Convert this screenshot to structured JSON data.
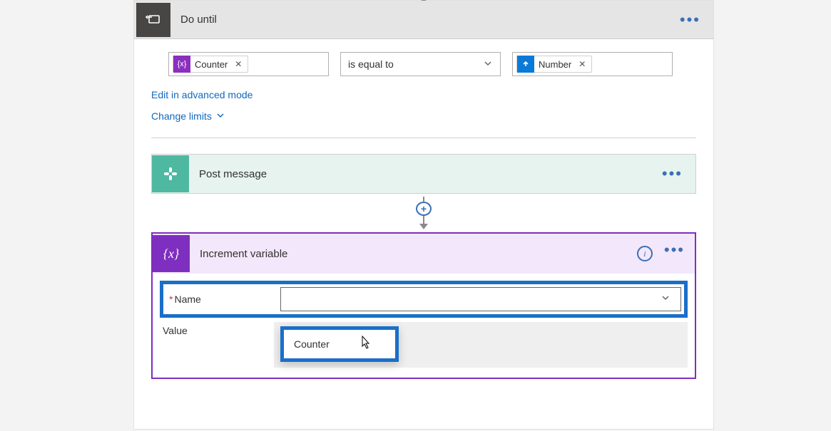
{
  "do_until": {
    "title": "Do until",
    "condition": {
      "left_token": {
        "icon_label": "{x}",
        "name": "Counter"
      },
      "operator": "is equal to",
      "right_token": {
        "name": "Number"
      }
    },
    "edit_advanced": "Edit in advanced mode",
    "change_limits": "Change limits"
  },
  "post_message": {
    "title": "Post message"
  },
  "increment_variable": {
    "title": "Increment variable",
    "fields": {
      "name_label": "Name",
      "name_value": "",
      "value_label": "Value",
      "value_value": ""
    },
    "dropdown_options": [
      "Counter"
    ]
  }
}
